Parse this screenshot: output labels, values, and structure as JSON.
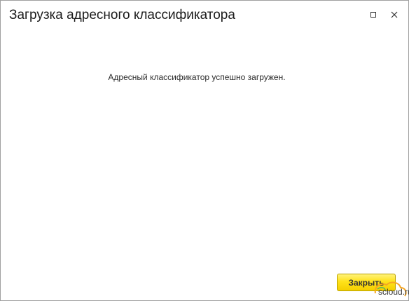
{
  "window": {
    "title": "Загрузка адресного классификатора",
    "maximize_icon": "maximize-icon",
    "close_icon": "close-icon"
  },
  "content": {
    "message": "Адресный классификатор успешно загружен."
  },
  "footer": {
    "close_label": "Закрыть"
  },
  "watermark": {
    "text": "scloud.ru"
  },
  "colors": {
    "button_yellow": "#ffe21a",
    "button_border": "#b8a100",
    "watermark_orange": "#f5a623"
  }
}
